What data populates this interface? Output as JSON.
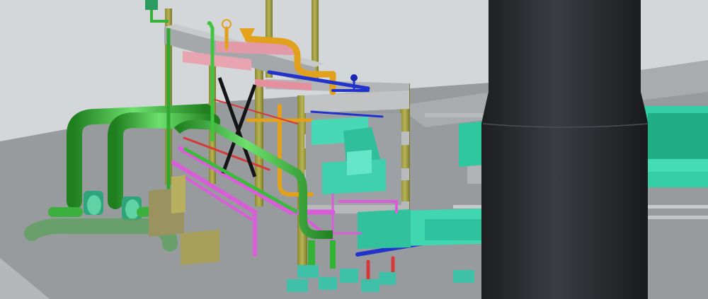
{
  "scene": {
    "subject": "3d-plant-piping-model",
    "colors": {
      "sky": "#d4d7d9",
      "floor": "#979a9c",
      "slab": "#b9bcbe",
      "column": "#a8a64a",
      "beam": "#a9abad",
      "green_pipe": "#3fbf3f",
      "magenta_pipe": "#d65bd6",
      "orange_pipe": "#e0a020",
      "cyan_equipment": "#3fd6b0",
      "stack": "#2a2d30",
      "blue_pipe": "#2233cc"
    }
  }
}
